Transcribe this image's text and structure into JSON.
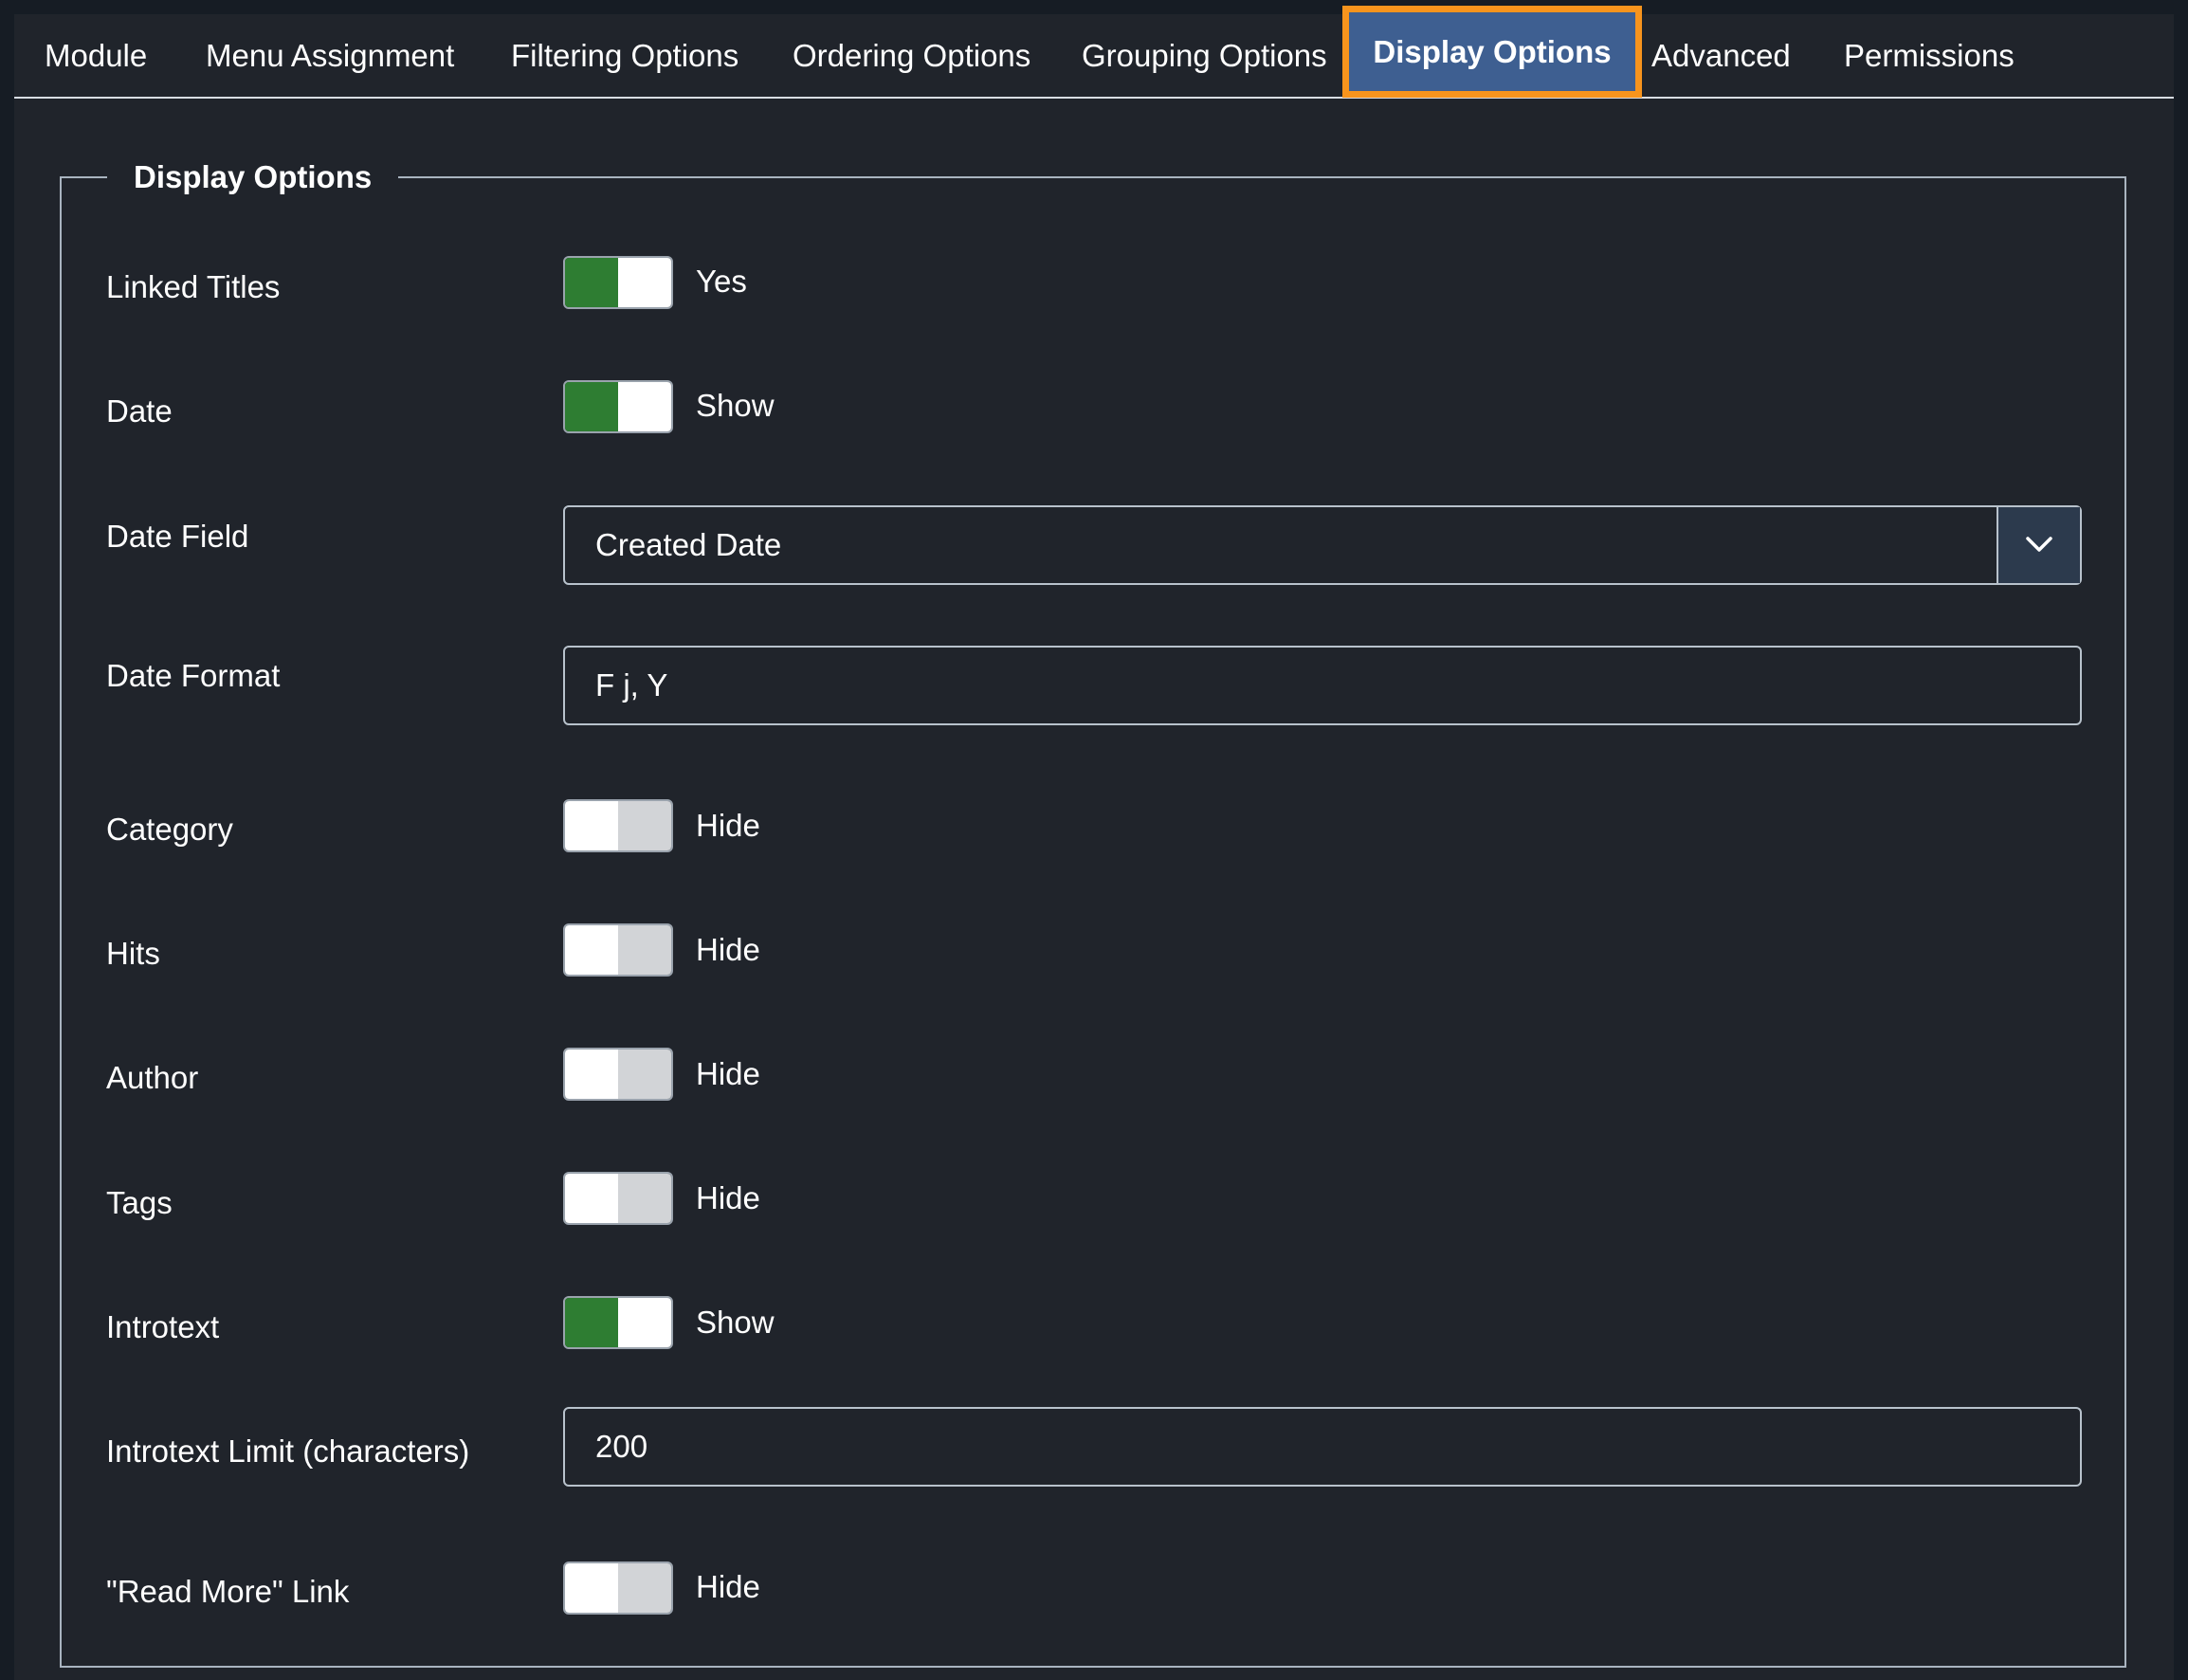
{
  "tabs": [
    {
      "label": "Module",
      "active": false
    },
    {
      "label": "Menu Assignment",
      "active": false
    },
    {
      "label": "Filtering Options",
      "active": false
    },
    {
      "label": "Ordering Options",
      "active": false
    },
    {
      "label": "Grouping Options",
      "active": false
    },
    {
      "label": "Display Options",
      "active": true
    },
    {
      "label": "Advanced",
      "active": false
    },
    {
      "label": "Permissions",
      "active": false
    }
  ],
  "fieldset": {
    "legend": "Display Options",
    "fields": {
      "linked_titles": {
        "label": "Linked Titles",
        "value": "Yes",
        "on": true
      },
      "date": {
        "label": "Date",
        "value": "Show",
        "on": true
      },
      "date_field": {
        "label": "Date Field",
        "value": "Created Date"
      },
      "date_format": {
        "label": "Date Format",
        "value": "F j, Y"
      },
      "category": {
        "label": "Category",
        "value": "Hide",
        "on": false
      },
      "hits": {
        "label": "Hits",
        "value": "Hide",
        "on": false
      },
      "author": {
        "label": "Author",
        "value": "Hide",
        "on": false
      },
      "tags": {
        "label": "Tags",
        "value": "Hide",
        "on": false
      },
      "introtext": {
        "label": "Introtext",
        "value": "Show",
        "on": true
      },
      "introtext_limit": {
        "label": "Introtext Limit (characters)",
        "value": "200"
      },
      "read_more": {
        "label": "\"Read More\" Link",
        "value": "Hide",
        "on": false
      }
    }
  },
  "colors": {
    "accent_active_tab": "#3e5f91",
    "active_tab_outline": "#f7941d",
    "switch_on": "#2e7d32",
    "switch_off": "#d2d4d7",
    "panel_bg": "#20242b"
  },
  "icons": {
    "select_caret": "chevron-down-icon"
  }
}
